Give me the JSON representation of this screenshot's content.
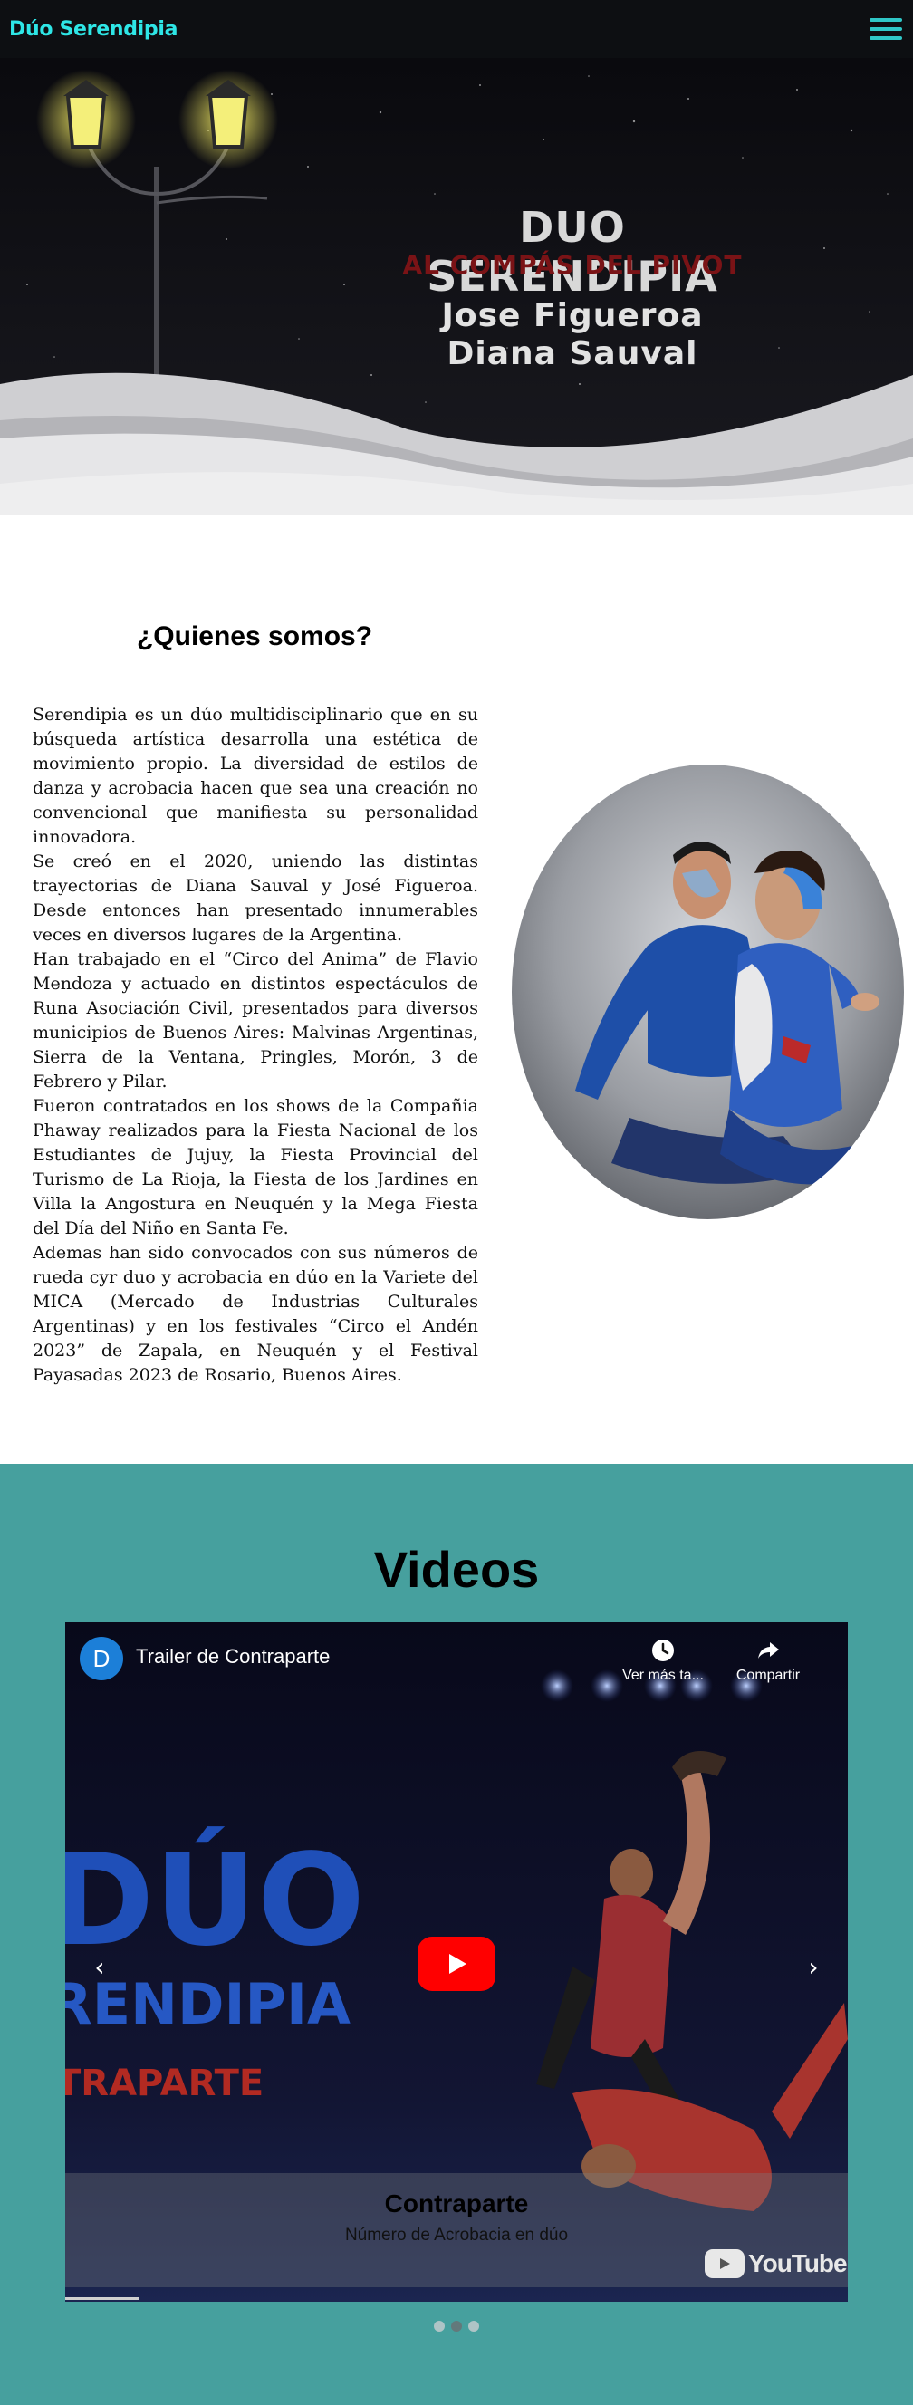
{
  "nav": {
    "brand": "Dúo Serendipia",
    "menu_icon": "hamburger-menu-icon"
  },
  "hero": {
    "title": "DUO SERENDIPIA",
    "subtitle": "AL COMPÁS DEL PIVOT",
    "name1": "Jose Figueroa",
    "name2": "Diana Sauval"
  },
  "about": {
    "title": "¿Quienes somos?",
    "paragraphs": [
      "Serendipia es un dúo multidisciplinario que en su búsqueda artística desarrolla una estética de movimiento propio. La diversidad de estilos de danza y acrobacia hacen que sea una creación no convencional que manifiesta su personalidad innovadora.",
      "Se creó en el 2020, uniendo las distintas trayectorias de Diana Sauval y José Figueroa. Desde entonces han presentado innumerables veces en diversos lugares de la Argentina.",
      "Han trabajado en el “Circo del Anima” de Flavio Mendoza y actuado en distintos espectáculos de Runa Asociación Civil, presentados para diversos municipios de Buenos Aires: Malvinas Argentinas, Sierra de la Ventana, Pringles, Morón, 3 de Febrero y Pilar.",
      "Fueron contratados en los shows de la Compañia Phaway realizados para la Fiesta Nacional de los Estudiantes de Jujuy, la Fiesta Provincial del Turismo de La Rioja, la Fiesta de los Jardines en Villa la Angostura en Neuquén y la Mega Fiesta del Día del Niño en Santa Fe.",
      "Ademas han sido convocados con sus números de rueda cyr duo y acrobacia en dúo en la Variete del MICA (Mercado de Industrias Culturales Argentinas) y en los festivales “Circo el Andén 2023” de Zapala, en Neuquén y el Festival Payasadas 2023 de Rosario, Buenos Aires."
    ]
  },
  "videos": {
    "title": "Videos",
    "player": {
      "channel_initial": "D",
      "video_title": "Trailer de Contraparte",
      "watch_later_label": "Ver más ta...",
      "share_label": "Compartir",
      "youtube_label": "YouTube",
      "thumbnail_text_1": "DÚO",
      "thumbnail_text_2": "RENDIPIA",
      "thumbnail_text_3": "TRAPARTE"
    },
    "caption": {
      "title": "Contraparte",
      "subtitle": "Número de Acrobacia en dúo"
    },
    "prev_label": "‹",
    "next_label": "›",
    "slides": 3,
    "active_slide": 2
  },
  "colors": {
    "brand": "#2ee6e6",
    "navbar_bg": "#0d0f12",
    "videos_bg": "#46a09e",
    "hero_subtitle": "#7a1316",
    "youtube_red": "#ff0000"
  }
}
